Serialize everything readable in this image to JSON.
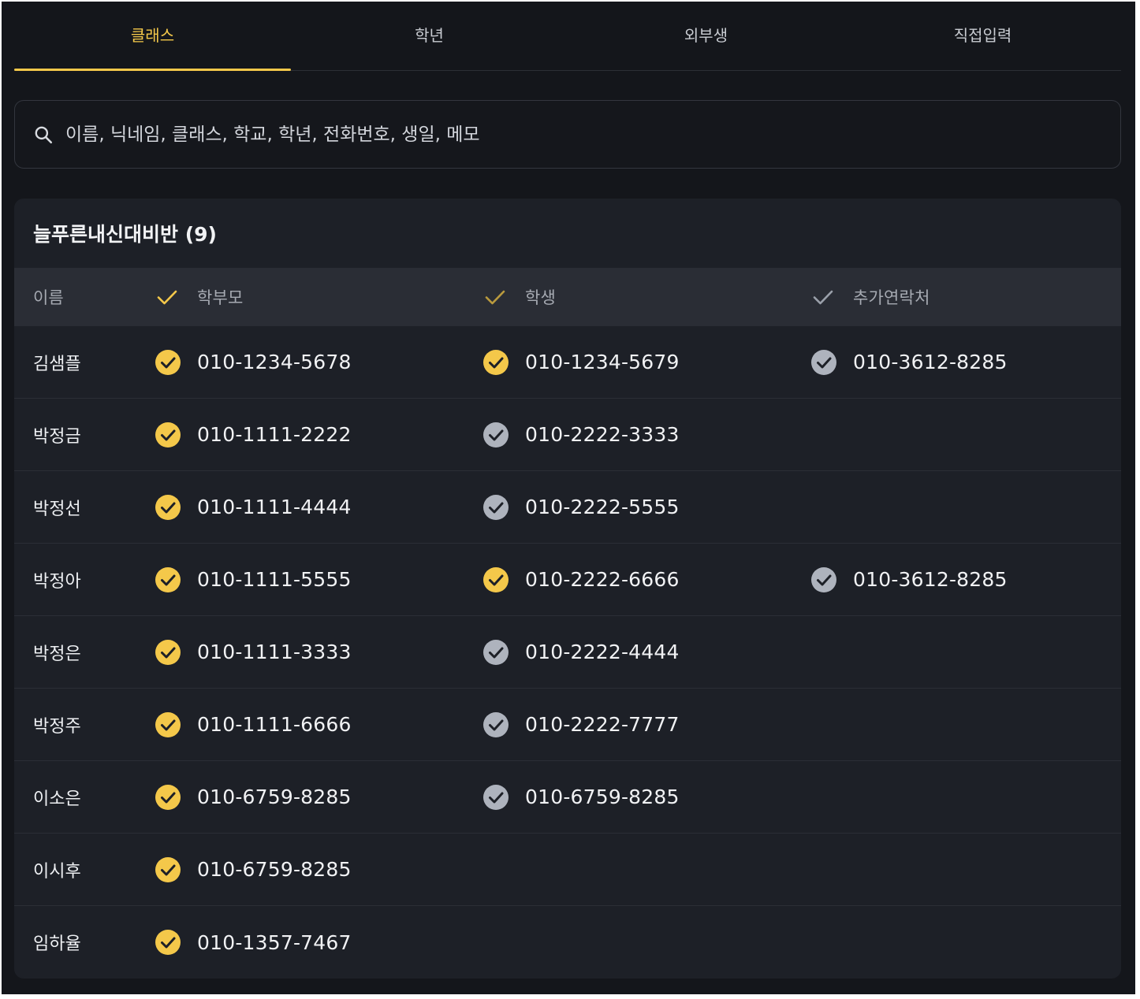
{
  "tabs": [
    {
      "label": "클래스",
      "active": true
    },
    {
      "label": "학년",
      "active": false
    },
    {
      "label": "외부생",
      "active": false
    },
    {
      "label": "직접입력",
      "active": false
    }
  ],
  "search": {
    "placeholder": "이름, 닉네임, 클래스, 학교, 학년, 전화번호, 생일, 메모",
    "value": ""
  },
  "group": {
    "title": "늘푸른내신대비반 (9)"
  },
  "table": {
    "headers": {
      "name": "이름",
      "parent": "학부모",
      "student": "학생",
      "extra": "추가연락처"
    },
    "header_checks": {
      "parent": "#f4c84a",
      "student": "#b99a3e",
      "extra": "#9aa0aa"
    },
    "rows": [
      {
        "name": "김샘플",
        "parent": {
          "phone": "010-1234-5678",
          "checked": true
        },
        "student": {
          "phone": "010-1234-5679",
          "checked": true
        },
        "extra": {
          "phone": "010-3612-8285",
          "checked": false
        }
      },
      {
        "name": "박정금",
        "parent": {
          "phone": "010-1111-2222",
          "checked": true
        },
        "student": {
          "phone": "010-2222-3333",
          "checked": false
        },
        "extra": null
      },
      {
        "name": "박정선",
        "parent": {
          "phone": "010-1111-4444",
          "checked": true
        },
        "student": {
          "phone": "010-2222-5555",
          "checked": false
        },
        "extra": null
      },
      {
        "name": "박정아",
        "parent": {
          "phone": "010-1111-5555",
          "checked": true
        },
        "student": {
          "phone": "010-2222-6666",
          "checked": true
        },
        "extra": {
          "phone": "010-3612-8285",
          "checked": false
        }
      },
      {
        "name": "박정은",
        "parent": {
          "phone": "010-1111-3333",
          "checked": true
        },
        "student": {
          "phone": "010-2222-4444",
          "checked": false
        },
        "extra": null
      },
      {
        "name": "박정주",
        "parent": {
          "phone": "010-1111-6666",
          "checked": true
        },
        "student": {
          "phone": "010-2222-7777",
          "checked": false
        },
        "extra": null
      },
      {
        "name": "이소은",
        "parent": {
          "phone": "010-6759-8285",
          "checked": true
        },
        "student": {
          "phone": "010-6759-8285",
          "checked": false
        },
        "extra": null
      },
      {
        "name": "이시후",
        "parent": {
          "phone": "010-6759-8285",
          "checked": true
        },
        "student": null,
        "extra": null
      },
      {
        "name": "임하율",
        "parent": {
          "phone": "010-1357-7467",
          "checked": true
        },
        "student": null,
        "extra": null
      }
    ]
  },
  "colors": {
    "accent": "#f4c84a",
    "unchecked": "#aeb3bd",
    "background": "#14161b",
    "card": "#1d2027"
  },
  "icons": {
    "search": "search-icon",
    "check_circle": "check-circle-icon",
    "check": "check-icon"
  }
}
